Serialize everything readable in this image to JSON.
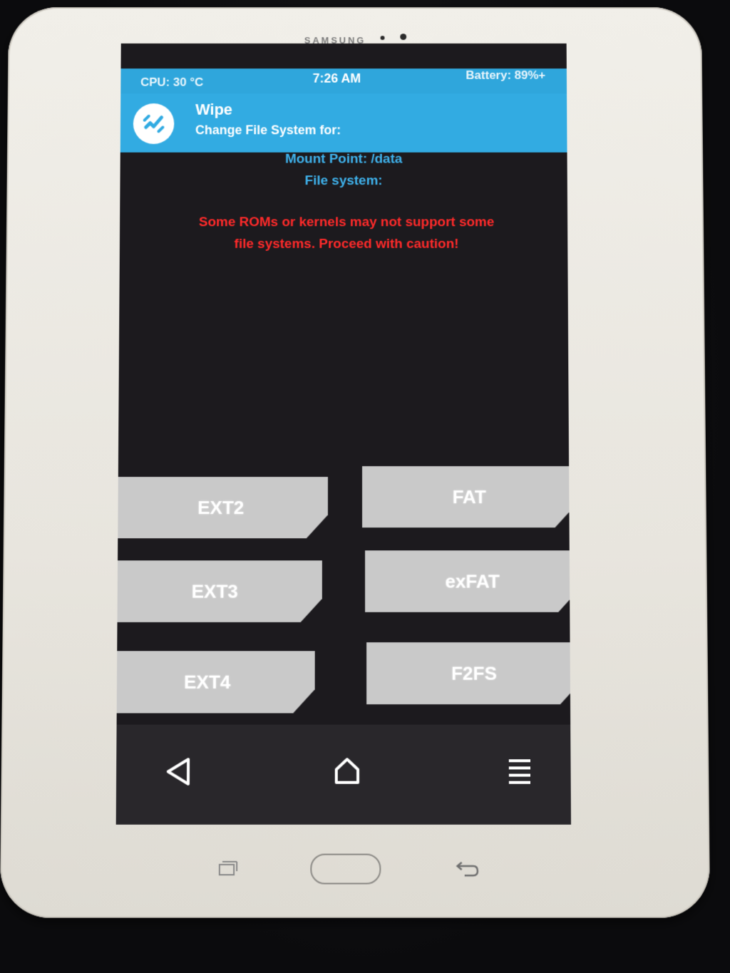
{
  "device": {
    "brand": "SAMSUNG"
  },
  "statusbar": {
    "cpu": "CPU: 30 °C",
    "time": "7:26 AM",
    "battery": "Battery: 89%+"
  },
  "header": {
    "title": "Wipe",
    "subtitle": "Change File System for:"
  },
  "info": {
    "mount_point": "Mount Point: /data",
    "file_system": "File system:"
  },
  "warning": {
    "line1": "Some ROMs or kernels may not support some",
    "line2": "file systems. Proceed with caution!"
  },
  "buttons": {
    "ext2": "EXT2",
    "fat": "FAT",
    "ext3": "EXT3",
    "exfat": "exFAT",
    "ext4": "EXT4",
    "f2fs": "F2FS"
  },
  "colors": {
    "accent": "#32abe2",
    "warning": "#ff2a2a",
    "button": "#c9c9c9",
    "screen_bg": "#1c1a1e"
  },
  "nav": {
    "back_icon": "back-triangle-icon",
    "home_icon": "home-icon",
    "menu_icon": "menu-icon"
  }
}
